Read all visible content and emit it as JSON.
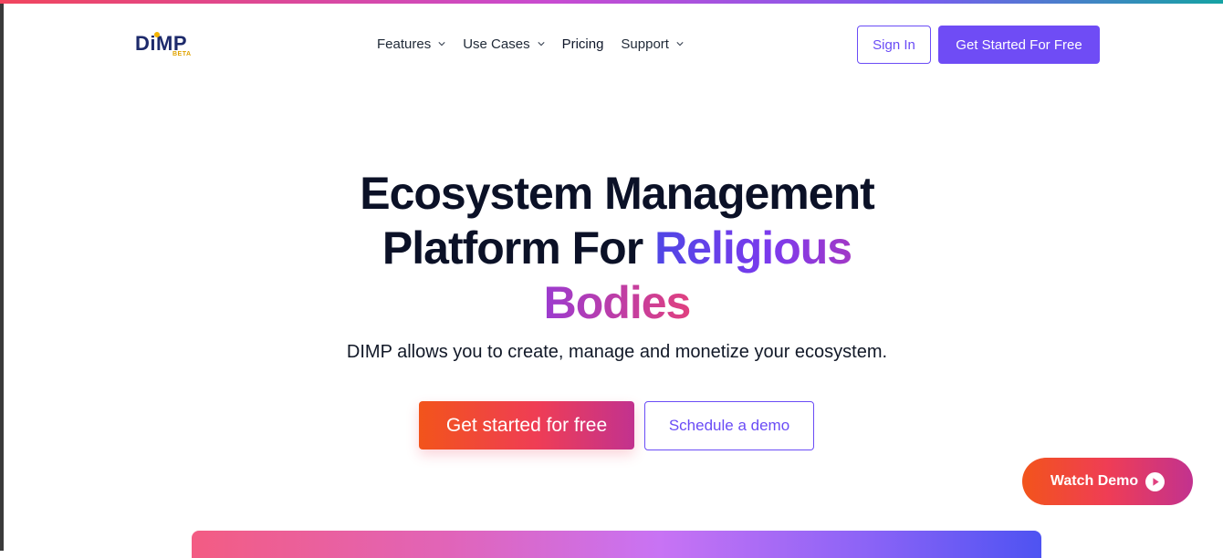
{
  "header": {
    "logo_text": "DiMP",
    "logo_badge": "BETA",
    "nav": [
      {
        "label": "Features",
        "icon": "chevron-down-icon"
      },
      {
        "label": "Use Cases",
        "icon": "chevron-down-icon"
      },
      {
        "label": "Pricing"
      },
      {
        "label": "Support",
        "icon": "chevron-down-icon"
      }
    ],
    "signin_label": "Sign In",
    "cta_label": "Get Started For Free"
  },
  "hero": {
    "title_line1": "Ecosystem Management",
    "title_line2_plain": "Platform For",
    "title_line2_accent": "Religious",
    "title_line3_accent": "Bodies",
    "subtitle": "DIMP allows you to create, manage and monetize your ecosystem.",
    "primary_button": "Get started for free",
    "secondary_button": "Schedule a demo"
  },
  "floating": {
    "watch_demo_label": "Watch Demo",
    "icon": "play-icon"
  },
  "colors": {
    "brand_purple": "#6f4cf5",
    "brand_navy": "#1d2a6b",
    "accent_orange": "#f2541b",
    "accent_pink": "#e0407f"
  }
}
